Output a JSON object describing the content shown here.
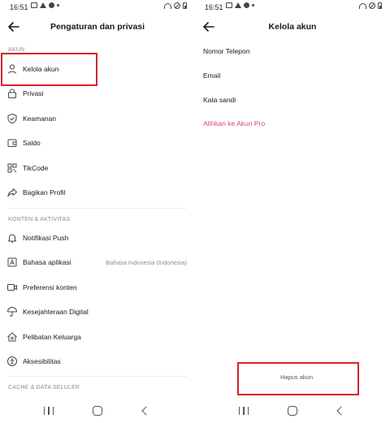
{
  "left": {
    "status": {
      "time": "16:51"
    },
    "header": {
      "title": "Pengaturan dan privasi"
    },
    "sections": [
      {
        "heading": "AKUN",
        "items": [
          {
            "label": "Kelola akun",
            "icon": "user-icon"
          },
          {
            "label": "Privasi",
            "icon": "lock-icon"
          },
          {
            "label": "Keamanan",
            "icon": "shield-icon"
          },
          {
            "label": "Saldo",
            "icon": "wallet-icon"
          },
          {
            "label": "TikCode",
            "icon": "qr-code-icon"
          },
          {
            "label": "Bagikan Profil",
            "icon": "share-icon"
          }
        ]
      },
      {
        "heading": "KONTEN & AKTIVITAS",
        "items": [
          {
            "label": "Notifikasi Push",
            "icon": "bell-icon"
          },
          {
            "label": "Bahasa aplikasi",
            "icon": "language-icon",
            "value": "Bahasa Indonesia (Indonesia)"
          },
          {
            "label": "Preferensi konten",
            "icon": "video-icon"
          },
          {
            "label": "Kesejahteraan Digital",
            "icon": "umbrella-icon"
          },
          {
            "label": "Pelibatan Keluarga",
            "icon": "home-icon"
          },
          {
            "label": "Aksesibilitas",
            "icon": "accessibility-icon"
          }
        ]
      },
      {
        "heading": "CACHE & DATA SELULER",
        "items": []
      }
    ]
  },
  "right": {
    "status": {
      "time": "16:51"
    },
    "header": {
      "title": "Kelola akun"
    },
    "items": [
      {
        "label": "Nomor Telepon"
      },
      {
        "label": "Email"
      },
      {
        "label": "Kata sandi"
      },
      {
        "label": "Alihkan ke Akun Pro"
      }
    ],
    "delete_label": "Hapus akun"
  },
  "colors": {
    "highlight": "#d22630",
    "accent_pink": "#e0436b",
    "muted": "#8a8b91"
  }
}
